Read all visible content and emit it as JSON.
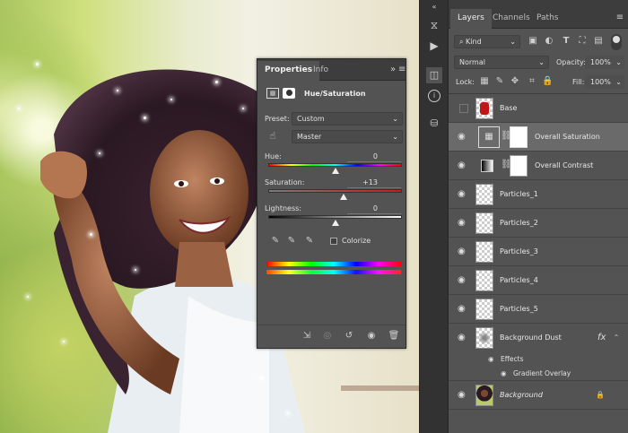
{
  "colors": {
    "accent": "#535353",
    "selected": "#6a6a6a",
    "tabbar": "#3d3d3d",
    "panel": "#535353"
  },
  "canvas": {
    "description_icon": "photo-canvas"
  },
  "tools": {
    "icons": [
      "history-icon",
      "play-icon",
      "adjustments-icon",
      "info-icon",
      "brush-settings-icon"
    ]
  },
  "layers_panel": {
    "tabs": [
      "Layers",
      "Channels",
      "Paths"
    ],
    "filter": {
      "value": "Kind"
    },
    "blend_mode": "Normal",
    "opacity_label": "Opacity:",
    "opacity_value": "100%",
    "lock_label": "Lock:",
    "fill_label": "Fill:",
    "fill_value": "100%",
    "layers": [
      {
        "name": "Base",
        "visible": false,
        "italic": false
      },
      {
        "name": "Overall Saturation",
        "visible": true,
        "selected": true
      },
      {
        "name": "Overall Contrast",
        "visible": true
      },
      {
        "name": "Particles_1",
        "visible": true
      },
      {
        "name": "Particles_2",
        "visible": true
      },
      {
        "name": "Particles_3",
        "visible": true
      },
      {
        "name": "Particles_4",
        "visible": true
      },
      {
        "name": "Particles_5",
        "visible": true
      },
      {
        "name": "Background Dust",
        "visible": true,
        "fx": "fx"
      },
      {
        "name": "Background",
        "visible": true,
        "italic": true
      }
    ],
    "effects_label": "Effects",
    "gradient_overlay_label": "Gradient Overlay"
  },
  "properties_panel": {
    "tabs": [
      "Properties",
      "Info"
    ],
    "title": "Hue/Saturation",
    "preset_label": "Preset:",
    "preset_value": "Custom",
    "channel_value": "Master",
    "hue_label": "Hue:",
    "hue_value": "0",
    "hue_level": 0.5,
    "saturation_label": "Saturation:",
    "saturation_value": "+13",
    "saturation_level": 0.565,
    "lightness_label": "Lightness:",
    "lightness_value": "0",
    "lightness_level": 0.5,
    "colorize_label": "Colorize"
  }
}
